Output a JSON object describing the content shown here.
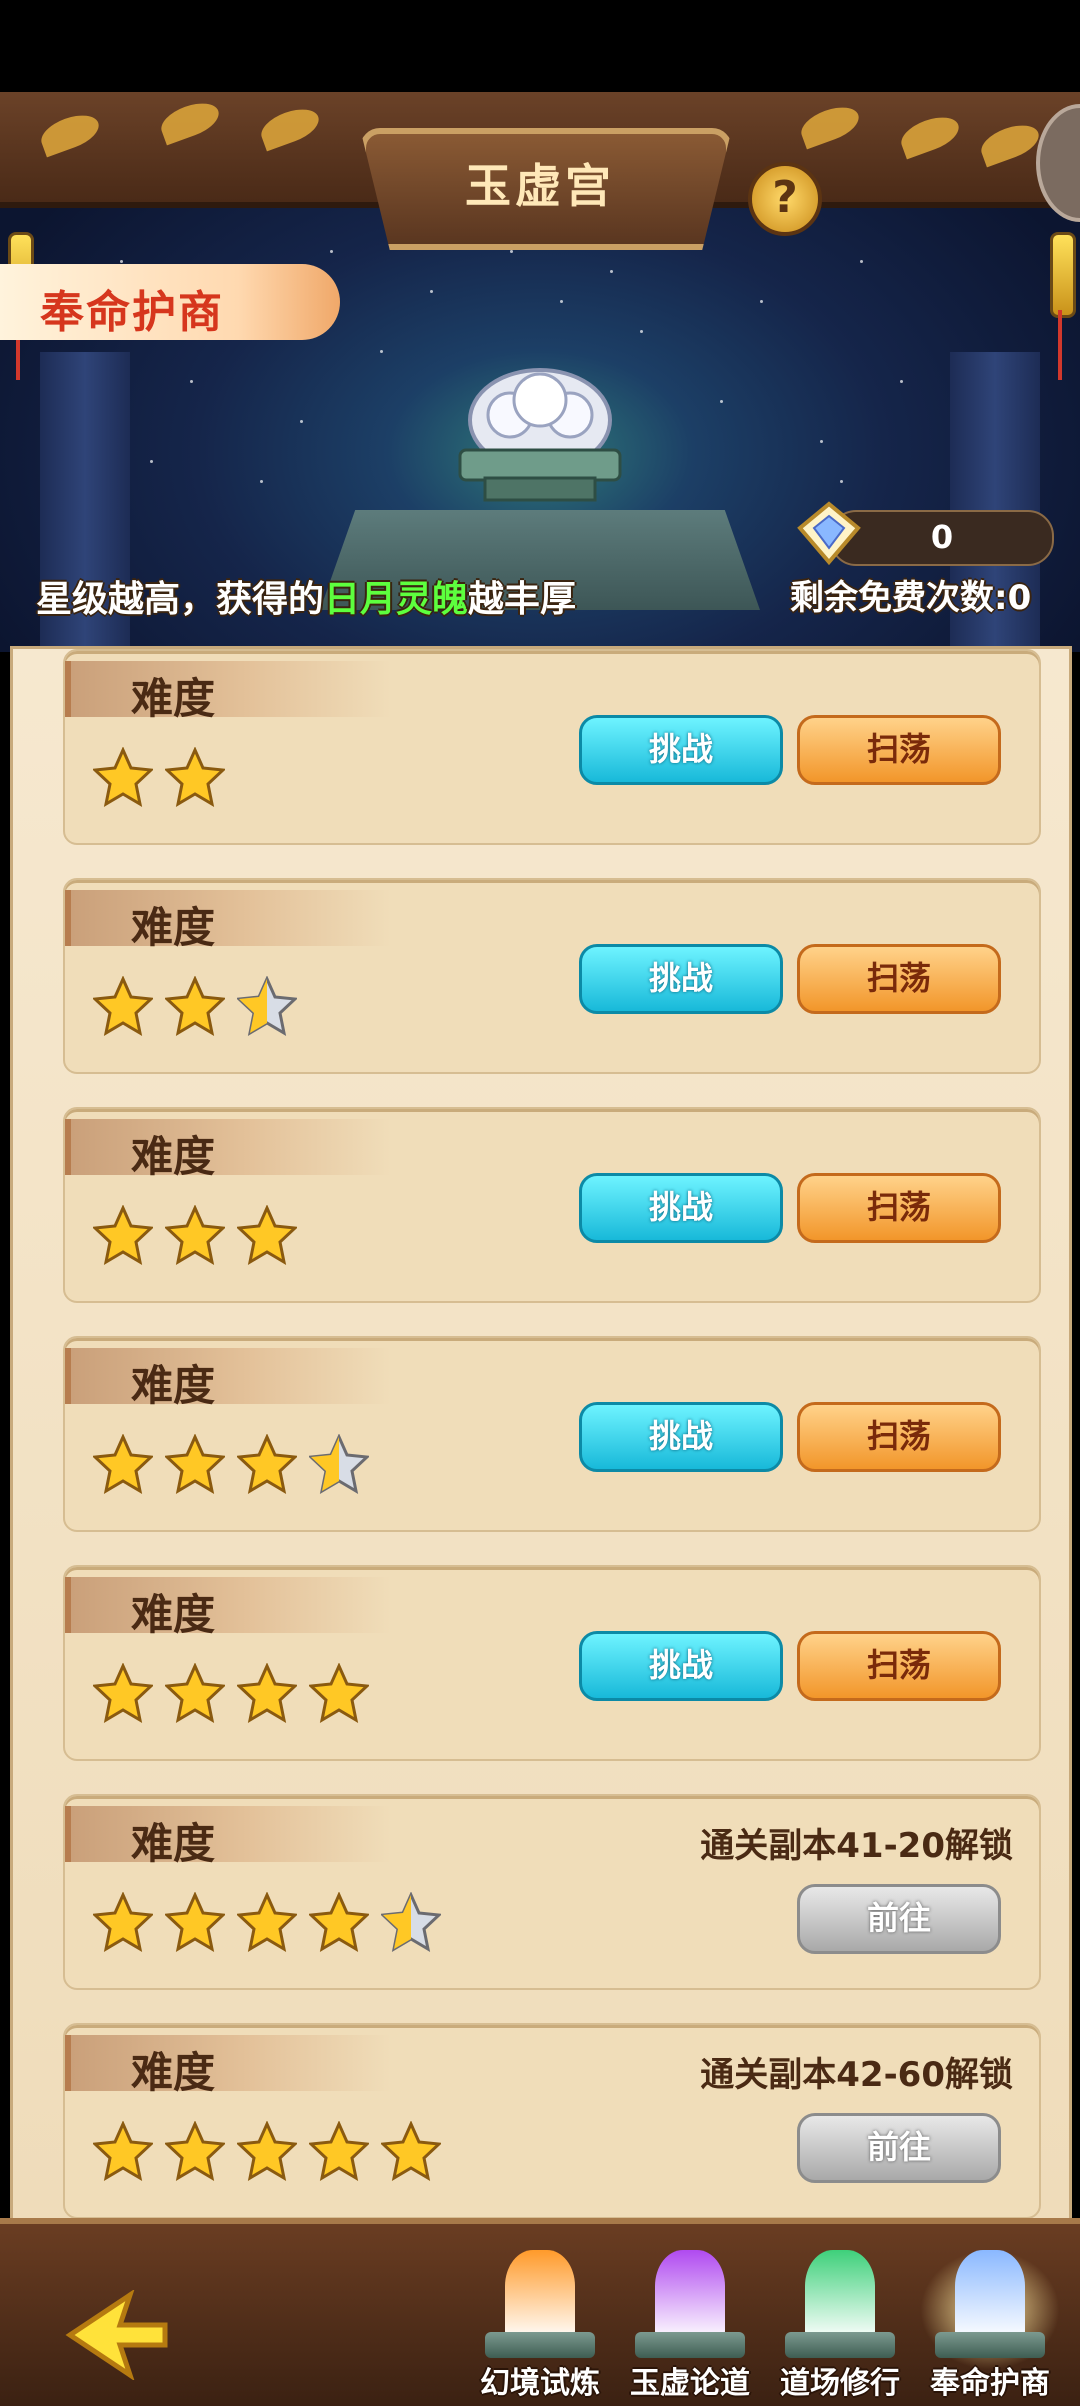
{
  "header": {
    "title": "玉虚宫",
    "help_icon": "?"
  },
  "mode_tag": "奉命护商",
  "banner": {
    "hint_prefix": "星级越高，获得的",
    "hint_highlight": "日月灵魄",
    "hint_suffix": "越丰厚",
    "remaining": "剩余免费次数:0",
    "ticket_count": "0"
  },
  "colors": {
    "challenge": "#18b9d9",
    "sweep": "#f2962a",
    "go": "#a9a9a9",
    "highlight": "#5dff3e"
  },
  "difficulties": [
    {
      "label": "难度",
      "stars": 2,
      "challenge": "挑战",
      "sweep": "扫荡"
    },
    {
      "label": "难度",
      "stars": 2.5,
      "challenge": "挑战",
      "sweep": "扫荡"
    },
    {
      "label": "难度",
      "stars": 3,
      "challenge": "挑战",
      "sweep": "扫荡"
    },
    {
      "label": "难度",
      "stars": 3.5,
      "challenge": "挑战",
      "sweep": "扫荡"
    },
    {
      "label": "难度",
      "stars": 4,
      "challenge": "挑战",
      "sweep": "扫荡"
    },
    {
      "label": "难度",
      "stars": 4.5,
      "unlock": "通关副本41-20解锁",
      "go": "前往"
    },
    {
      "label": "难度",
      "stars": 5,
      "unlock": "通关副本42-60解锁",
      "go": "前往"
    }
  ],
  "bottom_nav": [
    {
      "label": "幻境试炼",
      "icon": "orange-crystal-icon",
      "color": "#ff9a2a"
    },
    {
      "label": "玉虚论道",
      "icon": "purple-crystal-icon",
      "color": "#b04af0"
    },
    {
      "label": "道场修行",
      "icon": "green-crystal-icon",
      "color": "#3ed07a"
    },
    {
      "label": "奉命护商",
      "icon": "blue-crystal-icon",
      "color": "#8ab8ff",
      "active": true
    }
  ]
}
